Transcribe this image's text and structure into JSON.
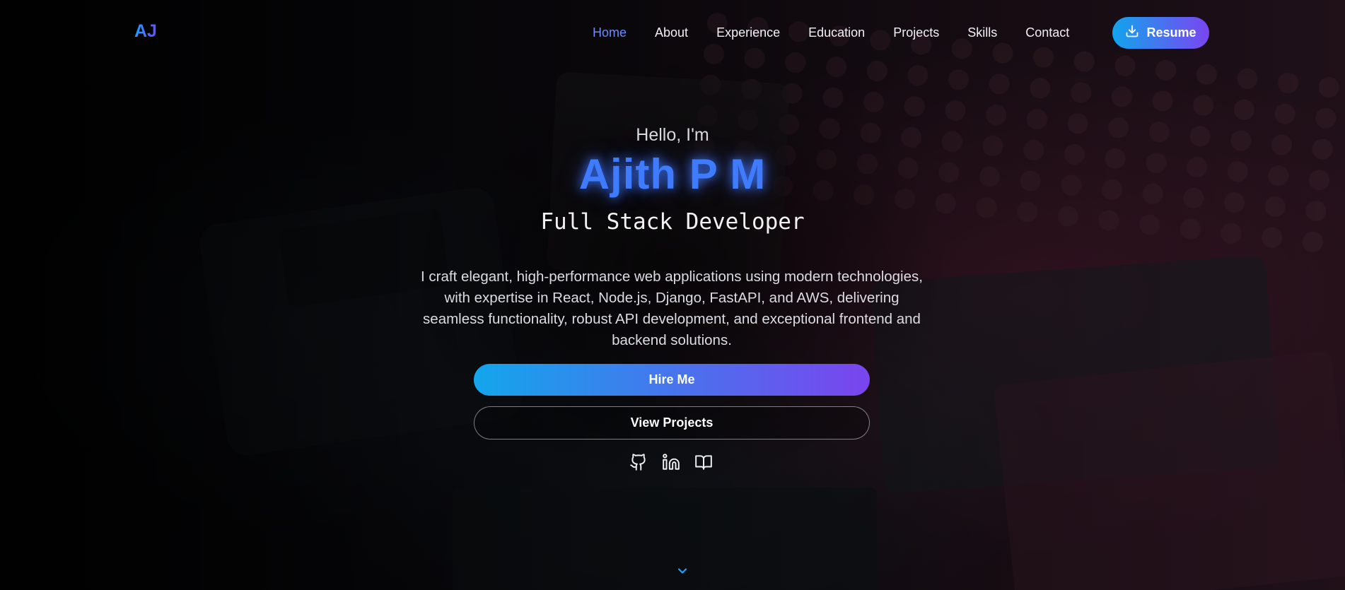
{
  "nav": {
    "logo": "AJ",
    "items": [
      {
        "label": "Home",
        "active": true
      },
      {
        "label": "About",
        "active": false
      },
      {
        "label": "Experience",
        "active": false
      },
      {
        "label": "Education",
        "active": false
      },
      {
        "label": "Projects",
        "active": false
      },
      {
        "label": "Skills",
        "active": false
      },
      {
        "label": "Contact",
        "active": false
      }
    ],
    "resume_label": "Resume",
    "resume_icon": "download-icon"
  },
  "hero": {
    "greeting": "Hello, I'm",
    "name": "Ajith P M",
    "role": "Full Stack Developer",
    "description": "I craft elegant, high-performance web applications using modern technologies, with expertise in React, Node.js, Django, FastAPI, and AWS, delivering seamless functionality, robust API development, and exceptional frontend and backend solutions.",
    "primary_button": "Hire Me",
    "secondary_button": "View Projects",
    "socials": [
      "github-icon",
      "linkedin-icon",
      "book-icon"
    ],
    "scroll_icon": "chevron-down-icon"
  },
  "colors": {
    "accent_blue": "#3f7bff",
    "gradient_start": "#13a6ec",
    "gradient_end": "#7a44ee",
    "active_nav": "#6b8cff"
  }
}
